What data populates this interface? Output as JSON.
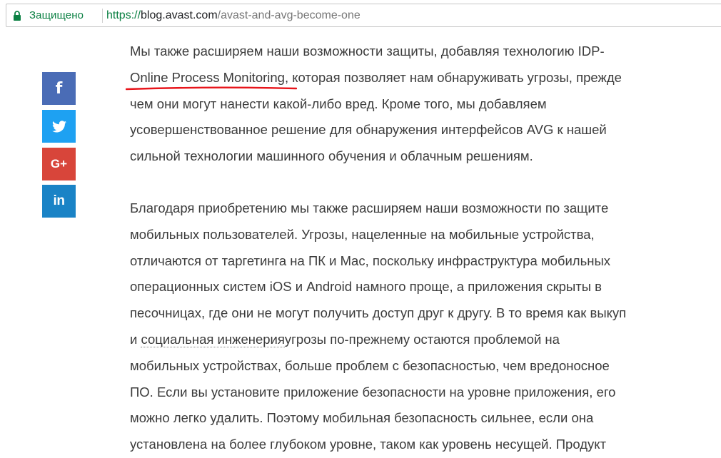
{
  "browser": {
    "secure_label": "Защищено",
    "url_scheme": "https://",
    "url_host": "blog.avast.com",
    "url_path": "/avast-and-avg-become-one",
    "secure_color": "#0b8043"
  },
  "social": {
    "facebook_glyph": "f",
    "twitter_icon": "twitter-icon",
    "googleplus_glyph": "G+",
    "linkedin_glyph": "in",
    "colors": {
      "facebook": "#4a6cb6",
      "twitter": "#1ea1f2",
      "googleplus": "#d8453a",
      "linkedin": "#1a83c6"
    }
  },
  "article": {
    "p1": {
      "l1": "Мы также расширяем наши возможности защиты, добавляя технологию IDP-",
      "l2_link": "Online Process Monitoring",
      "l2_rest": ", которая позволяет нам обнаруживать угрозы, прежде",
      "l3": "чем они могут нанести какой-либо вред. Кроме того, мы добавляем",
      "l4": "усовершенствованное решение для обнаружения интерфейсов AVG к нашей",
      "l5": "сильной технологии машинного обучения и облачным решениям."
    },
    "p2": {
      "l1": "Благодаря приобретению мы также расширяем наши возможности по защите",
      "l2": "мобильных пользователей. Угрозы, нацеленные на мобильные устройства,",
      "l3": "отличаются от таргетинга на ПК и Mac, поскольку инфраструктура мобильных",
      "l4": "операционных систем iOS и Android намного проще, а приложения скрыты в",
      "l5": "песочницах, где они не могут получить доступ друг к другу. В то время как выкуп",
      "l6_start": "и ",
      "l6_link": "социальная инженерия",
      "l6_rest": "угрозы по-прежнему остаются проблемой на",
      "l7": "мобильных устройствах, больше проблем с безопасностью, чем вредоносное",
      "l8": "ПО. Если вы установите приложение безопасности на уровне приложения, его",
      "l9": "можно легко удалить. Поэтому мобильная безопасность сильнее, если она",
      "l10": "установлена на более глубоком уровне, таком как уровень несущей. Продукт"
    }
  }
}
